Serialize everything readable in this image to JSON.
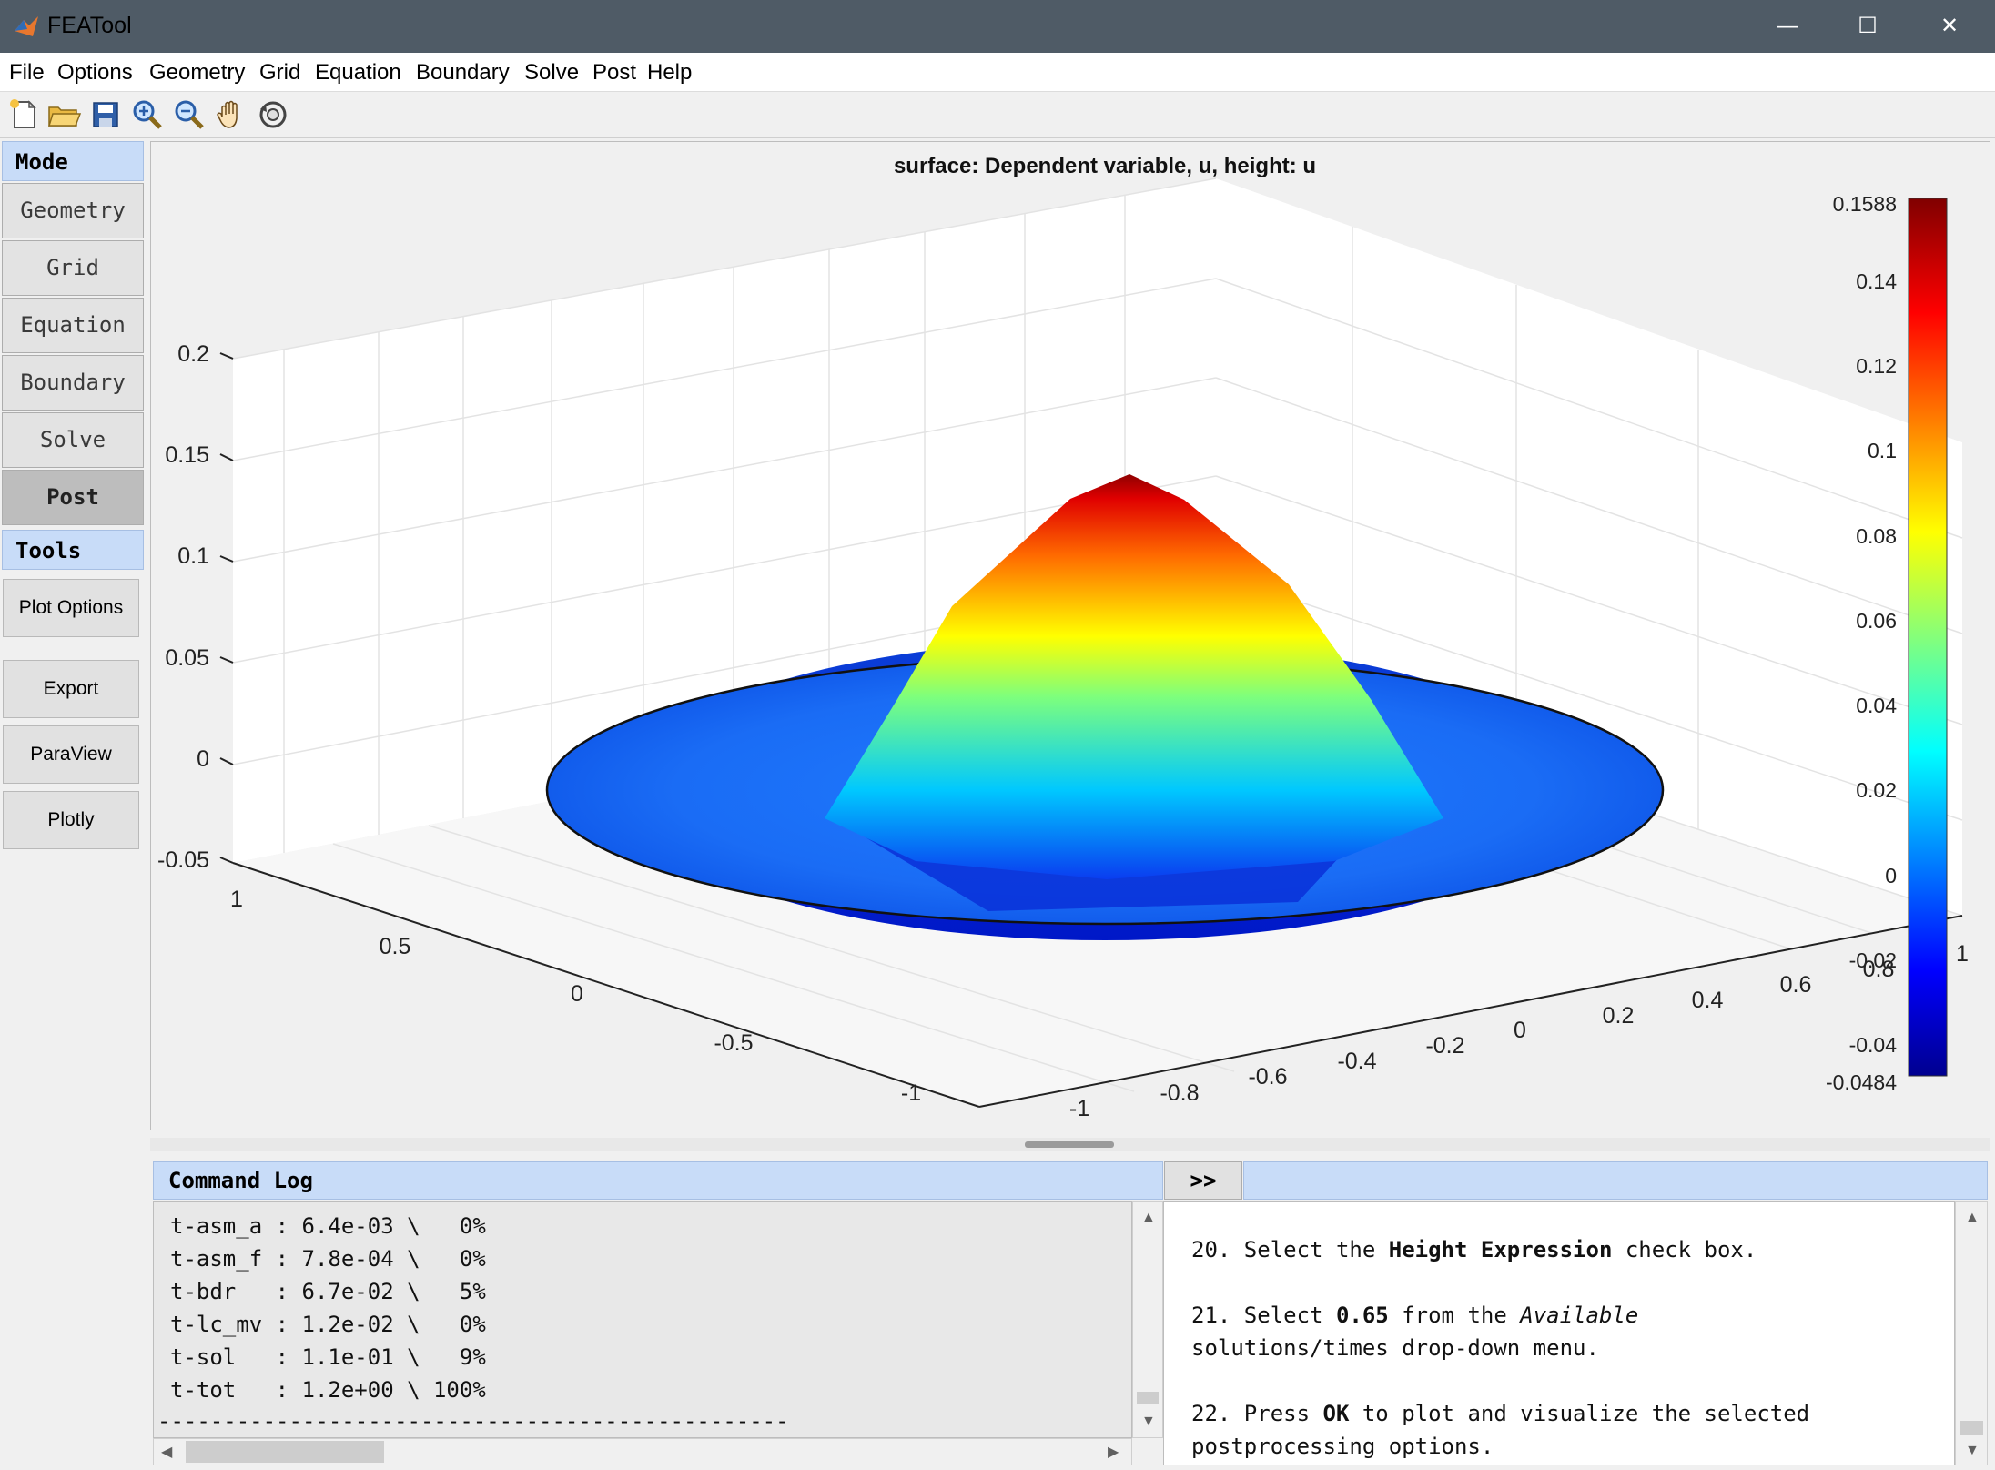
{
  "window": {
    "title": "FEATool",
    "controls": [
      "—",
      "☐",
      "✕"
    ]
  },
  "menu": [
    "File",
    "Options",
    "Geometry",
    "Grid",
    "Equation",
    "Boundary",
    "Solve",
    "Post",
    "Help"
  ],
  "toolbar": {
    "icons": [
      "new-file-icon",
      "open-folder-icon",
      "save-icon",
      "zoom-in-icon",
      "zoom-out-icon",
      "pan-hand-icon",
      "reset-view-icon"
    ]
  },
  "sidebar": {
    "mode_header": "Mode",
    "modes": [
      "Geometry",
      "Grid",
      "Equation",
      "Boundary",
      "Solve",
      "Post"
    ],
    "active_mode": "Post",
    "tools_header": "Tools",
    "tools": [
      "Plot Options",
      "Export",
      "ParaView",
      "Plotly"
    ]
  },
  "plot": {
    "title": "surface: Dependent variable, u, height: u",
    "z_ticks": [
      "0.2",
      "0.15",
      "0.1",
      "0.05",
      "0",
      "-0.05"
    ],
    "y_ticks": [
      "1",
      "0.5",
      "0",
      "-0.5",
      "-1"
    ],
    "x_ticks": [
      "-1",
      "-0.8",
      "-0.6",
      "-0.4",
      "-0.2",
      "0",
      "0.2",
      "0.4",
      "0.6",
      "0.8",
      "1"
    ],
    "colorbar": {
      "max_label": "0.1588",
      "min_label": "-0.0484",
      "ticks": [
        "0.14",
        "0.12",
        "0.1",
        "0.08",
        "0.06",
        "0.04",
        "0.02",
        "0",
        "-0.02",
        "-0.04"
      ],
      "colormap": "jet"
    },
    "surface": {
      "shape": "circular disk with central peak",
      "peak_value": 0.1588,
      "min_value": -0.0484,
      "base_value": 0
    }
  },
  "command_log": {
    "header": "Command Log",
    "toggle": ">>",
    "lines": [
      "t-asm_a : 6.4e-03 \\   0%",
      "t-asm_f : 7.8e-04 \\   0%",
      "t-bdr   : 6.7e-02 \\   5%",
      "t-lc_mv : 1.2e-02 \\   0%",
      "t-sol   : 1.1e-01 \\   9%",
      "t-tot   : 1.2e+00 \\ 100%",
      "------------------------------------------------"
    ]
  },
  "help": {
    "step20": {
      "pre": "20. Select the ",
      "bold": "Height Expression",
      "post": " check box."
    },
    "step21": {
      "pre": "21. Select ",
      "bold": "0.65",
      "mid": " from the ",
      "italic": "Available",
      "line2": "solutions/times drop-down menu."
    },
    "step22": {
      "pre": "22. Press ",
      "bold": "OK",
      "post": " to plot and visualize the selected",
      "line2": "postprocessing options."
    }
  }
}
